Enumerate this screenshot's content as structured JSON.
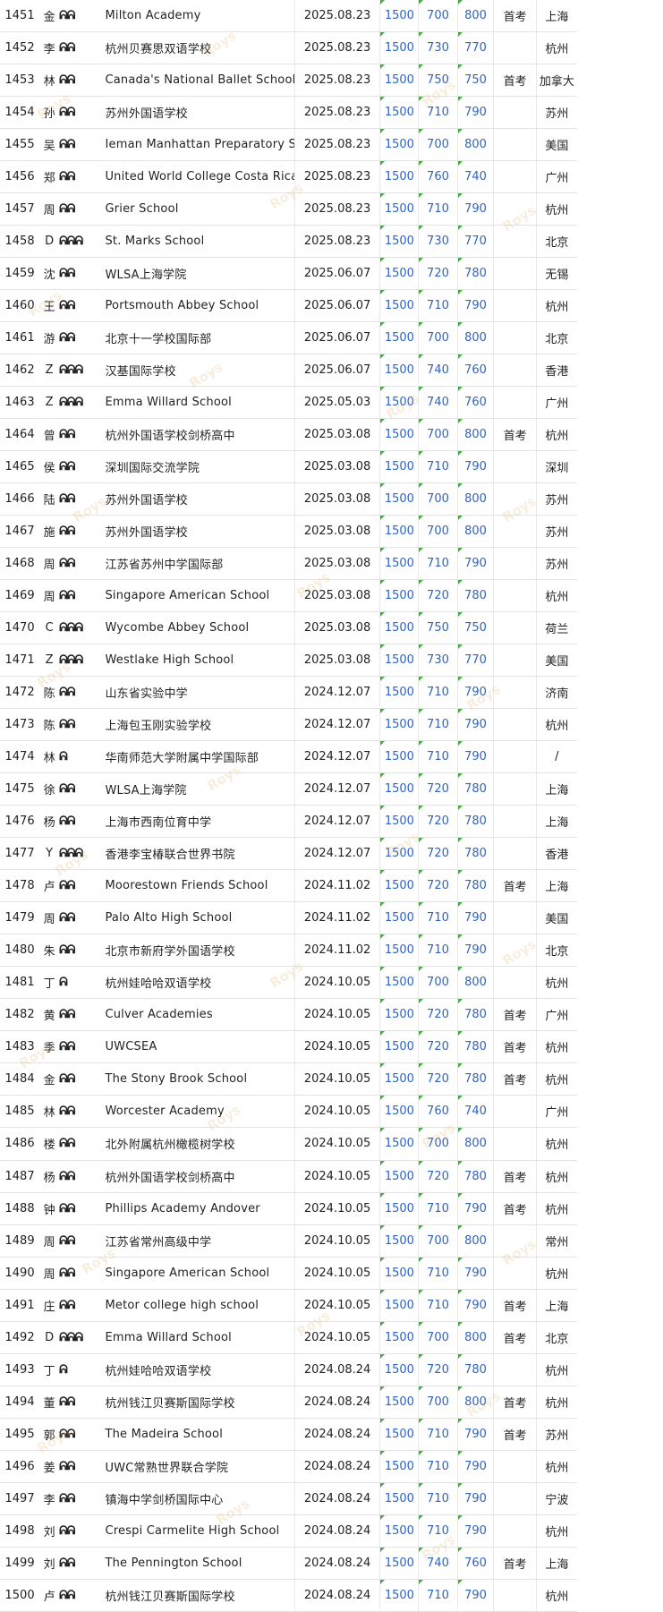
{
  "icon_legend": {
    "person": "person-icon"
  },
  "colors": {
    "score": "#2f63c4",
    "tick": "#4aa84a",
    "watermark": "#e1b26e"
  },
  "watermark_text": "Roys",
  "rows": [
    {
      "no": "1451",
      "name": "金",
      "icons": "ᕱᕱ",
      "school": "Milton Academy",
      "date": "2025.08.23",
      "total": "1500",
      "a": "700",
      "b": "800",
      "first": "首考",
      "city": "上海"
    },
    {
      "no": "1452",
      "name": "李",
      "icons": "ᕱᕱ",
      "school": "杭州贝赛思双语学校",
      "date": "2025.08.23",
      "total": "1500",
      "a": "730",
      "b": "770",
      "first": "",
      "city": "杭州"
    },
    {
      "no": "1453",
      "name": "林",
      "icons": "ᕱᕱ",
      "school": "Canada's National Ballet School",
      "date": "2025.08.23",
      "total": "1500",
      "a": "750",
      "b": "750",
      "first": "首考",
      "city": "加拿大"
    },
    {
      "no": "1454",
      "name": "孙",
      "icons": "ᕱᕱ",
      "school": "苏州外国语学校",
      "date": "2025.08.23",
      "total": "1500",
      "a": "710",
      "b": "790",
      "first": "",
      "city": "苏州"
    },
    {
      "no": "1455",
      "name": "吴",
      "icons": "ᕱᕱ",
      "school": "Ieman Manhattan Preparatory School",
      "date": "2025.08.23",
      "total": "1500",
      "a": "700",
      "b": "800",
      "first": "",
      "city": "美国"
    },
    {
      "no": "1456",
      "name": "郑",
      "icons": "ᕱᕱ",
      "school": "United World College Costa Rica",
      "date": "2025.08.23",
      "total": "1500",
      "a": "760",
      "b": "740",
      "first": "",
      "city": "广州"
    },
    {
      "no": "1457",
      "name": "周",
      "icons": "ᕱᕱ",
      "school": "Grier School",
      "date": "2025.08.23",
      "total": "1500",
      "a": "710",
      "b": "790",
      "first": "",
      "city": "杭州"
    },
    {
      "no": "1458",
      "name": "D",
      "icons": "ᕱᕱᕱ",
      "school": "St. Marks School",
      "date": "2025.08.23",
      "total": "1500",
      "a": "730",
      "b": "770",
      "first": "",
      "city": "北京"
    },
    {
      "no": "1459",
      "name": "沈",
      "icons": "ᕱᕱ",
      "school": "WLSA上海学院",
      "date": "2025.06.07",
      "total": "1500",
      "a": "720",
      "b": "780",
      "first": "",
      "city": "无锡"
    },
    {
      "no": "1460",
      "name": "王",
      "icons": "ᕱᕱ",
      "school": "Portsmouth Abbey School",
      "date": "2025.06.07",
      "total": "1500",
      "a": "710",
      "b": "790",
      "first": "",
      "city": "杭州"
    },
    {
      "no": "1461",
      "name": "游",
      "icons": "ᕱᕱ",
      "school": "北京十一学校国际部",
      "date": "2025.06.07",
      "total": "1500",
      "a": "700",
      "b": "800",
      "first": "",
      "city": "北京"
    },
    {
      "no": "1462",
      "name": "Z",
      "icons": "ᕱᕱᕱ",
      "school": "汉基国际学校",
      "date": "2025.06.07",
      "total": "1500",
      "a": "740",
      "b": "760",
      "first": "",
      "city": "香港"
    },
    {
      "no": "1463",
      "name": "Z",
      "icons": "ᕱᕱᕱ",
      "school": "Emma Willard School",
      "date": "2025.05.03",
      "total": "1500",
      "a": "740",
      "b": "760",
      "first": "",
      "city": "广州"
    },
    {
      "no": "1464",
      "name": "曾",
      "icons": "ᕱᕱ",
      "school": "杭州外国语学校剑桥高中",
      "date": "2025.03.08",
      "total": "1500",
      "a": "700",
      "b": "800",
      "first": "首考",
      "city": "杭州"
    },
    {
      "no": "1465",
      "name": "侯",
      "icons": "ᕱᕱ",
      "school": "深圳国际交流学院",
      "date": "2025.03.08",
      "total": "1500",
      "a": "710",
      "b": "790",
      "first": "",
      "city": "深圳"
    },
    {
      "no": "1466",
      "name": "陆",
      "icons": "ᕱᕱ",
      "school": "苏州外国语学校",
      "date": "2025.03.08",
      "total": "1500",
      "a": "700",
      "b": "800",
      "first": "",
      "city": "苏州"
    },
    {
      "no": "1467",
      "name": "施",
      "icons": "ᕱᕱ",
      "school": "苏州外国语学校",
      "date": "2025.03.08",
      "total": "1500",
      "a": "700",
      "b": "800",
      "first": "",
      "city": "苏州"
    },
    {
      "no": "1468",
      "name": "周",
      "icons": "ᕱᕱ",
      "school": "江苏省苏州中学国际部",
      "date": "2025.03.08",
      "total": "1500",
      "a": "710",
      "b": "790",
      "first": "",
      "city": "苏州"
    },
    {
      "no": "1469",
      "name": "周",
      "icons": "ᕱᕱ",
      "school": "Singapore American School",
      "date": "2025.03.08",
      "total": "1500",
      "a": "720",
      "b": "780",
      "first": "",
      "city": "杭州"
    },
    {
      "no": "1470",
      "name": "C",
      "icons": "ᕱᕱᕱ",
      "school": "Wycombe Abbey School",
      "date": "2025.03.08",
      "total": "1500",
      "a": "750",
      "b": "750",
      "first": "",
      "city": "荷兰"
    },
    {
      "no": "1471",
      "name": "Z",
      "icons": "ᕱᕱᕱ",
      "school": "Westlake High School",
      "date": "2025.03.08",
      "total": "1500",
      "a": "730",
      "b": "770",
      "first": "",
      "city": "美国"
    },
    {
      "no": "1472",
      "name": "陈",
      "icons": "ᕱᕱ",
      "school": "山东省实验中学",
      "date": "2024.12.07",
      "total": "1500",
      "a": "710",
      "b": "790",
      "first": "",
      "city": "济南"
    },
    {
      "no": "1473",
      "name": "陈",
      "icons": "ᕱᕱ",
      "school": "上海包玉刚实验学校",
      "date": "2024.12.07",
      "total": "1500",
      "a": "710",
      "b": "790",
      "first": "",
      "city": "杭州"
    },
    {
      "no": "1474",
      "name": "林",
      "icons": "ᕱ",
      "school": "华南师范大学附属中学国际部",
      "date": "2024.12.07",
      "total": "1500",
      "a": "710",
      "b": "790",
      "first": "",
      "city": "/"
    },
    {
      "no": "1475",
      "name": "徐",
      "icons": "ᕱᕱ",
      "school": "WLSA上海学院",
      "date": "2024.12.07",
      "total": "1500",
      "a": "720",
      "b": "780",
      "first": "",
      "city": "上海"
    },
    {
      "no": "1476",
      "name": "杨",
      "icons": "ᕱᕱ",
      "school": "上海市西南位育中学",
      "date": "2024.12.07",
      "total": "1500",
      "a": "720",
      "b": "780",
      "first": "",
      "city": "上海"
    },
    {
      "no": "1477",
      "name": "Y",
      "icons": "ᕱᕱᕱ",
      "school": "香港李宝椿联合世界书院",
      "date": "2024.12.07",
      "total": "1500",
      "a": "720",
      "b": "780",
      "first": "",
      "city": "香港"
    },
    {
      "no": "1478",
      "name": "卢",
      "icons": "ᕱᕱ",
      "school": "Moorestown Friends School",
      "date": "2024.11.02",
      "total": "1500",
      "a": "720",
      "b": "780",
      "first": "首考",
      "city": "上海"
    },
    {
      "no": "1479",
      "name": "周",
      "icons": "ᕱᕱ",
      "school": "Palo Alto High School",
      "date": "2024.11.02",
      "total": "1500",
      "a": "710",
      "b": "790",
      "first": "",
      "city": "美国"
    },
    {
      "no": "1480",
      "name": "朱",
      "icons": "ᕱᕱ",
      "school": "北京市新府学外国语学校",
      "date": "2024.11.02",
      "total": "1500",
      "a": "710",
      "b": "790",
      "first": "",
      "city": "北京"
    },
    {
      "no": "1481",
      "name": "丁",
      "icons": "ᕱ",
      "school": "杭州娃哈哈双语学校",
      "date": "2024.10.05",
      "total": "1500",
      "a": "700",
      "b": "800",
      "first": "",
      "city": "杭州"
    },
    {
      "no": "1482",
      "name": "黄",
      "icons": "ᕱᕱ",
      "school": "Culver Academies",
      "date": "2024.10.05",
      "total": "1500",
      "a": "720",
      "b": "780",
      "first": "首考",
      "city": "广州"
    },
    {
      "no": "1483",
      "name": "季",
      "icons": "ᕱᕱ",
      "school": "UWCSEA",
      "date": "2024.10.05",
      "total": "1500",
      "a": "720",
      "b": "780",
      "first": "首考",
      "city": "杭州"
    },
    {
      "no": "1484",
      "name": "金",
      "icons": "ᕱᕱ",
      "school": "The Stony Brook School",
      "date": "2024.10.05",
      "total": "1500",
      "a": "720",
      "b": "780",
      "first": "首考",
      "city": "杭州"
    },
    {
      "no": "1485",
      "name": "林",
      "icons": "ᕱᕱ",
      "school": "Worcester Academy",
      "date": "2024.10.05",
      "total": "1500",
      "a": "760",
      "b": "740",
      "first": "",
      "city": "广州"
    },
    {
      "no": "1486",
      "name": "楼",
      "icons": "ᕱᕱ",
      "school": "北外附属杭州橄榄树学校",
      "date": "2024.10.05",
      "total": "1500",
      "a": "700",
      "b": "800",
      "first": "",
      "city": "杭州"
    },
    {
      "no": "1487",
      "name": "杨",
      "icons": "ᕱᕱ",
      "school": "杭州外国语学校剑桥高中",
      "date": "2024.10.05",
      "total": "1500",
      "a": "720",
      "b": "780",
      "first": "首考",
      "city": "杭州"
    },
    {
      "no": "1488",
      "name": "钟",
      "icons": "ᕱᕱ",
      "school": "Phillips Academy Andover",
      "date": "2024.10.05",
      "total": "1500",
      "a": "710",
      "b": "790",
      "first": "首考",
      "city": "杭州"
    },
    {
      "no": "1489",
      "name": "周",
      "icons": "ᕱᕱ",
      "school": "江苏省常州高级中学",
      "date": "2024.10.05",
      "total": "1500",
      "a": "700",
      "b": "800",
      "first": "",
      "city": "常州"
    },
    {
      "no": "1490",
      "name": "周",
      "icons": "ᕱᕱ",
      "school": "Singapore American School",
      "date": "2024.10.05",
      "total": "1500",
      "a": "710",
      "b": "790",
      "first": "",
      "city": "杭州"
    },
    {
      "no": "1491",
      "name": "庄",
      "icons": "ᕱᕱ",
      "school": "Metor college high school",
      "date": "2024.10.05",
      "total": "1500",
      "a": "710",
      "b": "790",
      "first": "首考",
      "city": "上海"
    },
    {
      "no": "1492",
      "name": "D",
      "icons": "ᕱᕱᕱ",
      "school": "Emma Willard School",
      "date": "2024.10.05",
      "total": "1500",
      "a": "700",
      "b": "800",
      "first": "首考",
      "city": "北京"
    },
    {
      "no": "1493",
      "name": "丁",
      "icons": "ᕱ",
      "school": "杭州娃哈哈双语学校",
      "date": "2024.08.24",
      "total": "1500",
      "a": "720",
      "b": "780",
      "first": "",
      "city": "杭州"
    },
    {
      "no": "1494",
      "name": "董",
      "icons": "ᕱᕱ",
      "school": "杭州钱江贝赛斯国际学校",
      "date": "2024.08.24",
      "total": "1500",
      "a": "700",
      "b": "800",
      "first": "首考",
      "city": "杭州"
    },
    {
      "no": "1495",
      "name": "郭",
      "icons": "ᕱᕱ",
      "school": "The Madeira School",
      "date": "2024.08.24",
      "total": "1500",
      "a": "710",
      "b": "790",
      "first": "首考",
      "city": "苏州"
    },
    {
      "no": "1496",
      "name": "姜",
      "icons": "ᕱᕱ",
      "school": "UWC常熟世界联合学院",
      "date": "2024.08.24",
      "total": "1500",
      "a": "710",
      "b": "790",
      "first": "",
      "city": "杭州"
    },
    {
      "no": "1497",
      "name": "李",
      "icons": "ᕱᕱ",
      "school": "镇海中学剑桥国际中心",
      "date": "2024.08.24",
      "total": "1500",
      "a": "710",
      "b": "790",
      "first": "",
      "city": "宁波"
    },
    {
      "no": "1498",
      "name": "刘",
      "icons": "ᕱᕱ",
      "school": "Crespi Carmelite High School",
      "date": "2024.08.24",
      "total": "1500",
      "a": "710",
      "b": "790",
      "first": "",
      "city": "杭州"
    },
    {
      "no": "1499",
      "name": "刘",
      "icons": "ᕱᕱ",
      "school": "The Pennington School",
      "date": "2024.08.24",
      "total": "1500",
      "a": "740",
      "b": "760",
      "first": "首考",
      "city": "上海"
    },
    {
      "no": "1500",
      "name": "卢",
      "icons": "ᕱᕱ",
      "school": "杭州钱江贝赛斯国际学校",
      "date": "2024.08.24",
      "total": "1500",
      "a": "710",
      "b": "790",
      "first": "",
      "city": "杭州"
    }
  ]
}
